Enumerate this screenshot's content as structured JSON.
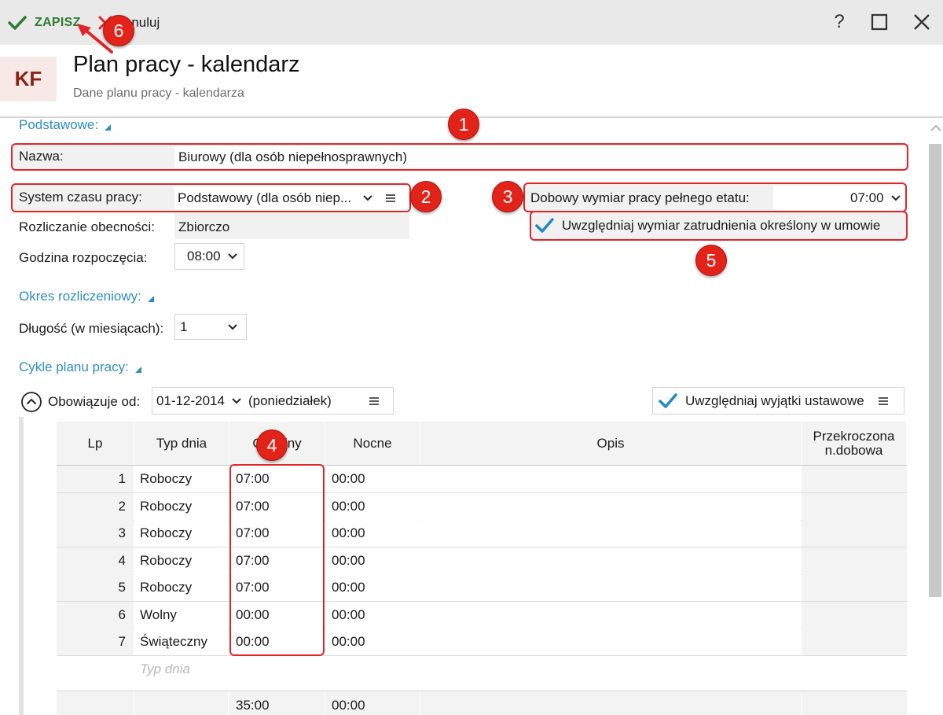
{
  "toolbar": {
    "save_label": "ZAPISZ",
    "cancel_label": "Anuluj",
    "help_label": "?"
  },
  "header": {
    "logo": "KF",
    "title": "Plan pracy - kalendarz",
    "subtitle": "Dane planu pracy - kalendarza"
  },
  "sections": {
    "basic": "Podstawowe:",
    "period": "Okres rozliczeniowy:",
    "cycles": "Cykle planu pracy:"
  },
  "fields": {
    "name_label": "Nazwa:",
    "name_value": "Biurowy (dla osób niepełnosprawnych)",
    "system_label": "System czasu pracy:",
    "system_value": "Podstawowy (dla osób niep...",
    "settlement_label": "Rozliczanie obecności:",
    "settlement_value": "Zbiorczo",
    "start_label": "Godzina rozpoczęcia:",
    "start_value": "08:00",
    "daily_label": "Dobowy wymiar pracy pełnego etatu:",
    "daily_value": "07:00",
    "contract_checkbox_label": "Uwzględniaj wymiar zatrudnienia określony w umowie",
    "length_label": "Długość (w miesiącach):",
    "length_value": "1",
    "valid_from_label": "Obowiązuje od:",
    "valid_from_value": "01-12-2014",
    "valid_from_day": "(poniedziałek)",
    "exceptions_checkbox_label": "Uwzględniaj wyjątki ustawowe"
  },
  "table": {
    "columns": [
      "Lp",
      "Typ dnia",
      "Godziny",
      "Nocne",
      "Opis",
      "Przekroczona n.dobowa"
    ],
    "rows": [
      {
        "lp": "1",
        "type": "Roboczy",
        "hours": "07:00",
        "night": "00:00"
      },
      {
        "lp": "2",
        "type": "Roboczy",
        "hours": "07:00",
        "night": "00:00"
      },
      {
        "lp": "3",
        "type": "Roboczy",
        "hours": "07:00",
        "night": "00:00"
      },
      {
        "lp": "4",
        "type": "Roboczy",
        "hours": "07:00",
        "night": "00:00"
      },
      {
        "lp": "5",
        "type": "Roboczy",
        "hours": "07:00",
        "night": "00:00"
      },
      {
        "lp": "6",
        "type": "Wolny",
        "hours": "00:00",
        "night": "00:00"
      },
      {
        "lp": "7",
        "type": "Świąteczny",
        "hours": "00:00",
        "night": "00:00"
      }
    ],
    "new_row_placeholder": "Typ dnia",
    "totals": {
      "hours": "35:00",
      "night": "00:00"
    }
  },
  "annotations": [
    "1",
    "2",
    "3",
    "4",
    "5",
    "6"
  ],
  "colors": {
    "accent": "#2d8dbf",
    "save": "#2e7d32",
    "cancel": "#e0262b",
    "annotation": "#e2231a",
    "logo": "#8b2214"
  }
}
